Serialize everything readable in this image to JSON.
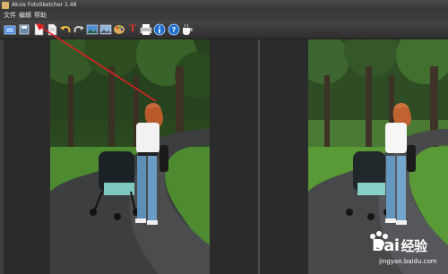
{
  "window": {
    "title": "Akvis FotoSketcher 1.48"
  },
  "menu": {
    "items": [
      {
        "label": "文件"
      },
      {
        "label": "编辑"
      },
      {
        "label": "帮助"
      }
    ]
  },
  "toolbar": {
    "buttons": [
      {
        "name": "open-icon"
      },
      {
        "name": "save-icon"
      },
      {
        "name": "page-icon"
      },
      {
        "name": "page2-icon"
      },
      {
        "name": "undo-icon"
      },
      {
        "name": "redo-icon"
      },
      {
        "name": "image-icon"
      },
      {
        "name": "image2-icon"
      },
      {
        "name": "palette-icon"
      },
      {
        "name": "text-icon"
      },
      {
        "name": "print-icon"
      },
      {
        "name": "info-icon"
      },
      {
        "name": "help-icon"
      },
      {
        "name": "coffee-icon"
      }
    ]
  },
  "watermark": {
    "brand": "Bai",
    "brand2": "经验",
    "url": "jingyan.baidu.com"
  },
  "colors": {
    "window_bg": "#3a3a3a",
    "pane_bg": "#2b2b2b",
    "arrow": "#e02020",
    "accent": "#1f6fd0"
  }
}
